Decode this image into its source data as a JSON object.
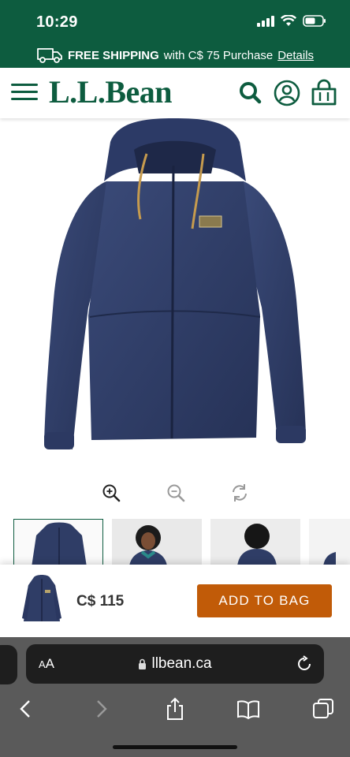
{
  "status_bar": {
    "time": "10:29"
  },
  "shipping_banner": {
    "bold_text": "FREE SHIPPING",
    "text": "with C$ 75 Purchase",
    "link": "Details",
    "icon": "truck-icon"
  },
  "header": {
    "logo": "L.L.Bean",
    "icons": [
      "menu-icon",
      "search-icon",
      "account-icon",
      "bag-icon"
    ]
  },
  "product_viewer": {
    "controls": [
      "zoom-in-icon",
      "zoom-out-icon",
      "rotate-icon"
    ],
    "thumbnails": [
      "jacket-front",
      "model-front",
      "model-back",
      "partial"
    ]
  },
  "buy_bar": {
    "price": "C$ 115",
    "button_label": "ADD TO BAG",
    "button_color": "#c15b08"
  },
  "browser": {
    "aa_label_small": "A",
    "aa_label_large": "A",
    "url": "llbean.ca"
  },
  "colors": {
    "brand_green": "#0d5c3f",
    "jacket_navy": "#2f3d66"
  }
}
